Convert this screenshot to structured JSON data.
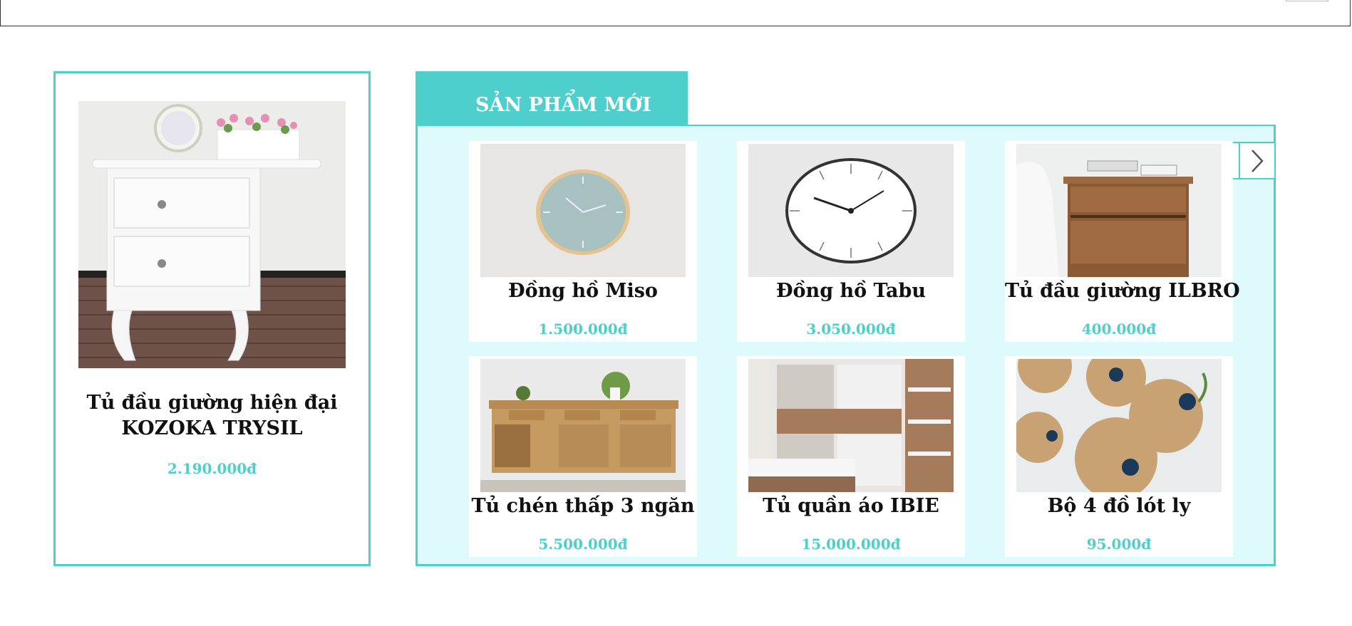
{
  "featured": {
    "name": "Tủ đầu giường hiện đại\nKOZOKA TRYSIL",
    "price": "2.190.000đ",
    "image_icon": "white-nightstand-photo"
  },
  "new_products": {
    "title": "SẢN PHẨM MỚI",
    "prev_icon": "chevron-left-icon",
    "next_icon": "chevron-right-icon",
    "items": [
      {
        "name": "Đồng hồ Miso",
        "price": "1.500.000đ",
        "image_icon": "wall-clock-miso-photo"
      },
      {
        "name": "Đồng hồ Tabu",
        "price": "3.050.000đ",
        "image_icon": "wall-clock-tabu-photo"
      },
      {
        "name": "Tủ đầu giường ILBRO",
        "price": "400.000đ",
        "image_icon": "wooden-nightstand-photo"
      },
      {
        "name": "Tủ chén thấp 3 ngăn",
        "price": "5.500.000đ",
        "image_icon": "sideboard-cabinet-photo"
      },
      {
        "name": "Tủ quần áo IBIE",
        "price": "15.000.000đ",
        "image_icon": "wardrobe-photo"
      },
      {
        "name": "Bộ 4 đồ lót ly",
        "price": "95.000đ",
        "image_icon": "cork-coasters-photo"
      }
    ]
  },
  "colors": {
    "accent": "#4ecfcc",
    "panel_bg": "#dffafa"
  }
}
